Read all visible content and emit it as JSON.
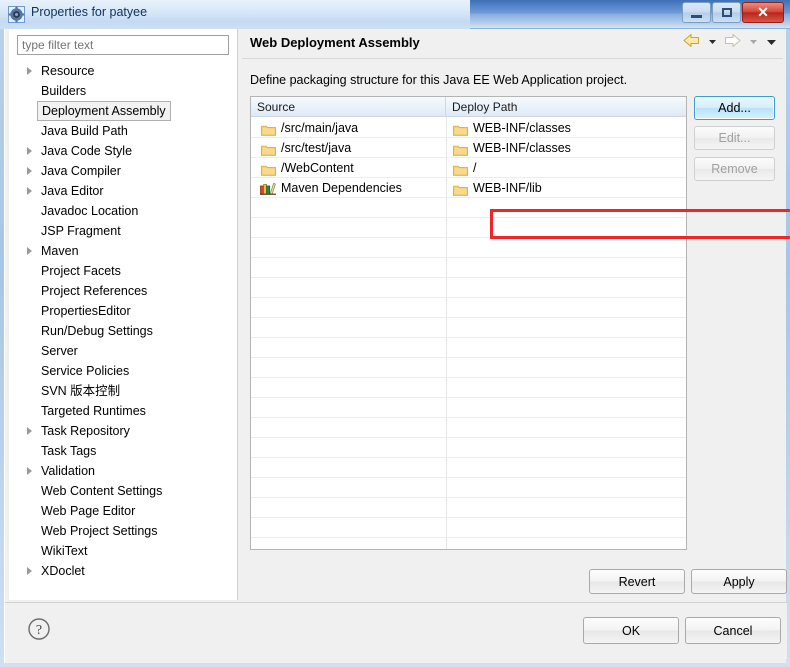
{
  "window": {
    "title": "Properties for patyee",
    "icon": "properties-gear-icon",
    "minimize_label": "",
    "maximize_label": "",
    "close_label": "✕"
  },
  "sidebar": {
    "filter": {
      "placeholder": "type filter text",
      "value": ""
    },
    "items": [
      {
        "label": "Resource",
        "expandable": true,
        "selected": false
      },
      {
        "label": "Builders",
        "expandable": false,
        "selected": false
      },
      {
        "label": "Deployment Assembly",
        "expandable": false,
        "selected": true
      },
      {
        "label": "Java Build Path",
        "expandable": false,
        "selected": false
      },
      {
        "label": "Java Code Style",
        "expandable": true,
        "selected": false
      },
      {
        "label": "Java Compiler",
        "expandable": true,
        "selected": false
      },
      {
        "label": "Java Editor",
        "expandable": true,
        "selected": false
      },
      {
        "label": "Javadoc Location",
        "expandable": false,
        "selected": false
      },
      {
        "label": "JSP Fragment",
        "expandable": false,
        "selected": false
      },
      {
        "label": "Maven",
        "expandable": true,
        "selected": false
      },
      {
        "label": "Project Facets",
        "expandable": false,
        "selected": false
      },
      {
        "label": "Project References",
        "expandable": false,
        "selected": false
      },
      {
        "label": "PropertiesEditor",
        "expandable": false,
        "selected": false
      },
      {
        "label": "Run/Debug Settings",
        "expandable": false,
        "selected": false
      },
      {
        "label": "Server",
        "expandable": false,
        "selected": false
      },
      {
        "label": "Service Policies",
        "expandable": false,
        "selected": false
      },
      {
        "label": "SVN 版本控制",
        "expandable": false,
        "selected": false
      },
      {
        "label": "Targeted Runtimes",
        "expandable": false,
        "selected": false
      },
      {
        "label": "Task Repository",
        "expandable": true,
        "selected": false
      },
      {
        "label": "Task Tags",
        "expandable": false,
        "selected": false
      },
      {
        "label": "Validation",
        "expandable": true,
        "selected": false
      },
      {
        "label": "Web Content Settings",
        "expandable": false,
        "selected": false
      },
      {
        "label": "Web Page Editor",
        "expandable": false,
        "selected": false
      },
      {
        "label": "Web Project Settings",
        "expandable": false,
        "selected": false
      },
      {
        "label": "WikiText",
        "expandable": false,
        "selected": false
      },
      {
        "label": "XDoclet",
        "expandable": true,
        "selected": false
      }
    ]
  },
  "page": {
    "title": "Web Deployment Assembly",
    "description": "Define packaging structure for this Java EE Web Application project.",
    "nav": {
      "back_icon": "back-arrow-icon",
      "back_menu_icon": "chevron-down-icon",
      "forward_icon": "forward-arrow-icon",
      "forward_menu_icon": "chevron-down-icon",
      "view_menu_icon": "chevron-down-icon"
    }
  },
  "table": {
    "columns": [
      "Source",
      "Deploy Path"
    ],
    "sort_column": "Source",
    "sort_direction": "ascending",
    "rows": [
      {
        "source": "/src/main/java",
        "source_icon": "folder-icon",
        "deploy": "WEB-INF/classes",
        "deploy_icon": "folder-icon",
        "highlighted": false
      },
      {
        "source": "/src/test/java",
        "source_icon": "folder-icon",
        "deploy": "WEB-INF/classes",
        "deploy_icon": "folder-icon",
        "highlighted": false
      },
      {
        "source": "/WebContent",
        "source_icon": "folder-icon",
        "deploy": "/",
        "deploy_icon": "folder-icon",
        "highlighted": false
      },
      {
        "source": "Maven Dependencies",
        "source_icon": "maven-dependencies-icon",
        "deploy": "WEB-INF/lib",
        "deploy_icon": "folder-icon",
        "highlighted": true
      }
    ],
    "empty_row_count": 18
  },
  "side_buttons": [
    {
      "label": "Add...",
      "enabled": true,
      "focused": true,
      "name": "add-button"
    },
    {
      "label": "Edit...",
      "enabled": false,
      "focused": false,
      "name": "edit-button"
    },
    {
      "label": "Remove",
      "enabled": false,
      "focused": false,
      "name": "remove-button"
    }
  ],
  "page_buttons": {
    "revert": "Revert",
    "apply": "Apply"
  },
  "footer": {
    "help_icon": "help-question-icon",
    "ok": "OK",
    "cancel": "Cancel"
  },
  "colors": {
    "highlight_box": "#f02626",
    "titlebar_blue": "#4c7ec4",
    "close_red": "#d6483a",
    "focus_blue": "#3c9dd4",
    "folder_yellow": "#f5c761"
  }
}
